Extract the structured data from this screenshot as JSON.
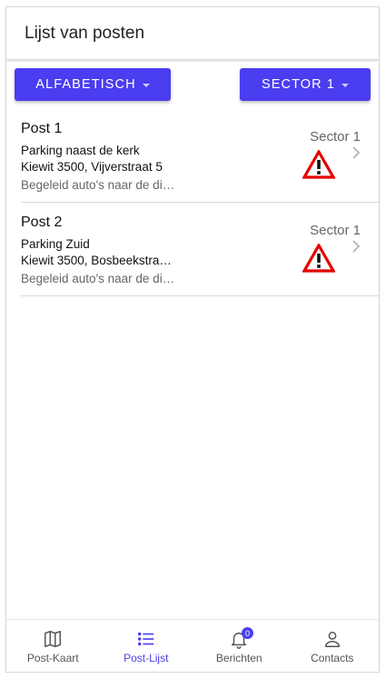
{
  "header": {
    "title": "Lijst van posten"
  },
  "toolbar": {
    "sort_label": "ALFABETISCH",
    "sector_label": "SECTOR 1"
  },
  "colors": {
    "accent": "#4b3df0",
    "warning": "#e60000"
  },
  "posts": [
    {
      "name": "Post 1",
      "location": "Parking naast de kerk",
      "address": "Kiewit 3500, Vijverstraat 5",
      "description": "Begeleid auto's naar de di…",
      "sector": "Sector 1",
      "status_icon": "warning-icon"
    },
    {
      "name": "Post 2",
      "location": "Parking Zuid",
      "address": "Kiewit 3500, Bosbeekstra…",
      "description": "Begeleid auto's naar de di…",
      "sector": "Sector 1",
      "status_icon": "warning-icon"
    }
  ],
  "tabs": [
    {
      "label": "Post-Kaart",
      "icon": "map-icon",
      "active": false
    },
    {
      "label": "Post-Lijst",
      "icon": "list-icon",
      "active": true
    },
    {
      "label": "Berichten",
      "icon": "bell-icon",
      "active": false,
      "badge": "0"
    },
    {
      "label": "Contacts",
      "icon": "person-icon",
      "active": false
    }
  ]
}
